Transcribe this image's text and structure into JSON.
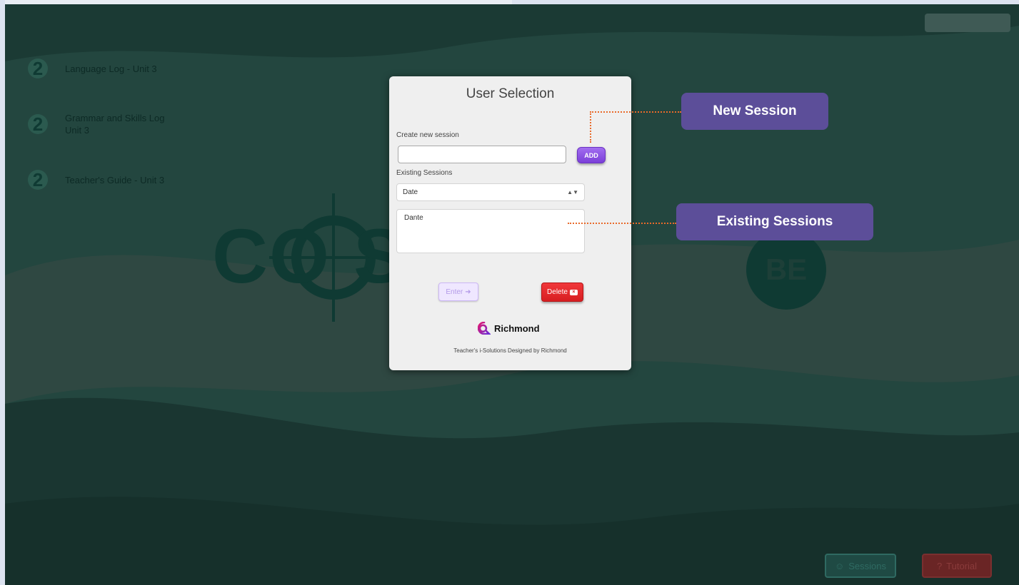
{
  "sidebar": {
    "items": [
      {
        "number": "2",
        "label": "Language Log - Unit 3"
      },
      {
        "number": "2",
        "label": "Grammar and Skills Log\nUnit 3"
      },
      {
        "number": "2",
        "label": "Teacher's Guide - Unit 3"
      }
    ]
  },
  "background": {
    "brand_word": "CO    SS",
    "brand_badge": "BE"
  },
  "footer_buttons": {
    "sessions": "Sessions",
    "tutorial": "Tutorial"
  },
  "modal": {
    "title": "User Selection",
    "create_label": "Create new session",
    "new_session_value": "",
    "add_label": "ADD",
    "existing_label": "Existing Sessions",
    "sort_selected": "Date",
    "sessions": [
      "Dante"
    ],
    "enter_label": "Enter",
    "delete_label": "Delete",
    "logo_text": "Richmond",
    "footer": "Teacher's i-Solutions Designed by Richmond"
  },
  "callouts": {
    "new_session": "New Session",
    "existing_sessions": "Existing Sessions"
  },
  "colors": {
    "background": "#1d3f38",
    "callout": "#5c4e99",
    "callout_line": "#e86a2a",
    "add": "#7b3fd8",
    "delete": "#d71e22"
  }
}
